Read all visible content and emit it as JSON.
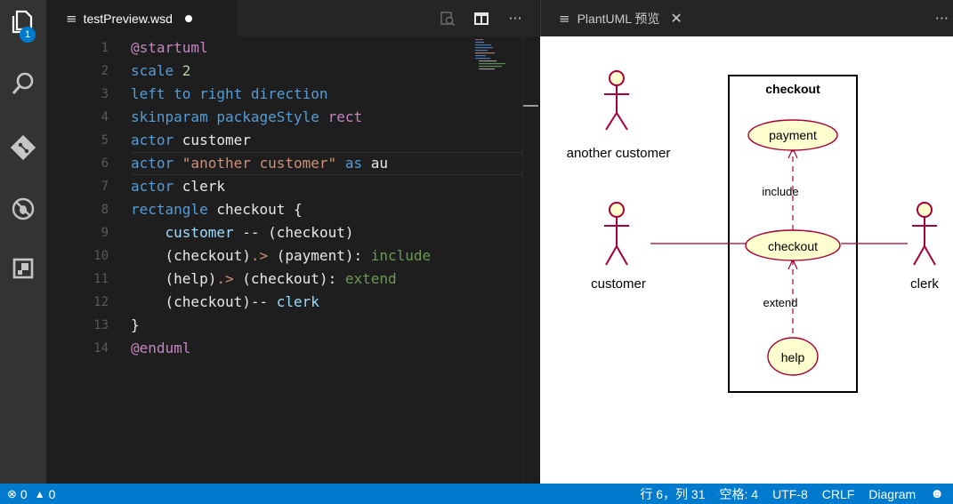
{
  "editor": {
    "tab_title": "testPreview.wsd",
    "lines": [
      {
        "n": "1",
        "tokens": [
          {
            "t": "@startuml",
            "c": "kw"
          }
        ]
      },
      {
        "n": "2",
        "tokens": [
          {
            "t": "scale ",
            "c": "bl"
          },
          {
            "t": "2",
            "c": "nm"
          }
        ]
      },
      {
        "n": "3",
        "tokens": [
          {
            "t": "left to right direction",
            "c": "bl"
          }
        ]
      },
      {
        "n": "4",
        "tokens": [
          {
            "t": "skinparam packageStyle ",
            "c": "bl"
          },
          {
            "t": "rect",
            "c": "kw"
          }
        ]
      },
      {
        "n": "5",
        "tokens": [
          {
            "t": "actor ",
            "c": "bl"
          },
          {
            "t": "customer",
            "c": "wh"
          }
        ]
      },
      {
        "n": "6",
        "tokens": [
          {
            "t": "actor ",
            "c": "bl"
          },
          {
            "t": "\"another customer\"",
            "c": "st"
          },
          {
            "t": " as ",
            "c": "bl"
          },
          {
            "t": "au",
            "c": "wh"
          }
        ]
      },
      {
        "n": "7",
        "tokens": [
          {
            "t": "actor ",
            "c": "bl"
          },
          {
            "t": "clerk",
            "c": "wh"
          }
        ]
      },
      {
        "n": "8",
        "tokens": [
          {
            "t": "rectangle ",
            "c": "bl"
          },
          {
            "t": "checkout {",
            "c": "wh"
          }
        ]
      },
      {
        "n": "9",
        "tokens": [
          {
            "t": "    customer ",
            "c": "id"
          },
          {
            "t": "-- ",
            "c": "wh"
          },
          {
            "t": "(checkout)",
            "c": "wh"
          }
        ]
      },
      {
        "n": "10",
        "tokens": [
          {
            "t": "    (checkout)",
            "c": "wh"
          },
          {
            "t": ".> ",
            "c": "st"
          },
          {
            "t": "(payment)",
            "c": "wh"
          },
          {
            "t": ": ",
            "c": "wh"
          },
          {
            "t": "include",
            "c": "gr"
          }
        ]
      },
      {
        "n": "11",
        "tokens": [
          {
            "t": "    (help)",
            "c": "wh"
          },
          {
            "t": ".> ",
            "c": "st"
          },
          {
            "t": "(checkout)",
            "c": "wh"
          },
          {
            "t": ": ",
            "c": "wh"
          },
          {
            "t": "extend",
            "c": "gr"
          }
        ]
      },
      {
        "n": "12",
        "tokens": [
          {
            "t": "    (checkout)",
            "c": "wh"
          },
          {
            "t": "-- ",
            "c": "wh"
          },
          {
            "t": "clerk",
            "c": "id"
          }
        ]
      },
      {
        "n": "13",
        "tokens": [
          {
            "t": "}",
            "c": "wh"
          }
        ]
      },
      {
        "n": "14",
        "tokens": [
          {
            "t": "@enduml",
            "c": "kw"
          }
        ]
      }
    ]
  },
  "preview": {
    "tab_title": "PlantUML 预览",
    "diagram": {
      "package_title": "checkout",
      "actors": [
        "another customer",
        "customer",
        "clerk"
      ],
      "usecases": [
        "payment",
        "checkout",
        "help"
      ],
      "labels": [
        "include",
        "extend"
      ]
    }
  },
  "activity_bar": {
    "badge": "1",
    "icons": [
      "files-icon",
      "search-icon",
      "git-icon",
      "debug-icon",
      "extensions-icon"
    ]
  },
  "status_bar": {
    "errors": "0",
    "warnings": "0",
    "position": "行 6，列 31",
    "indent": "空格: 4",
    "encoding": "UTF-8",
    "eol": "CRLF",
    "language": "Diagram"
  }
}
